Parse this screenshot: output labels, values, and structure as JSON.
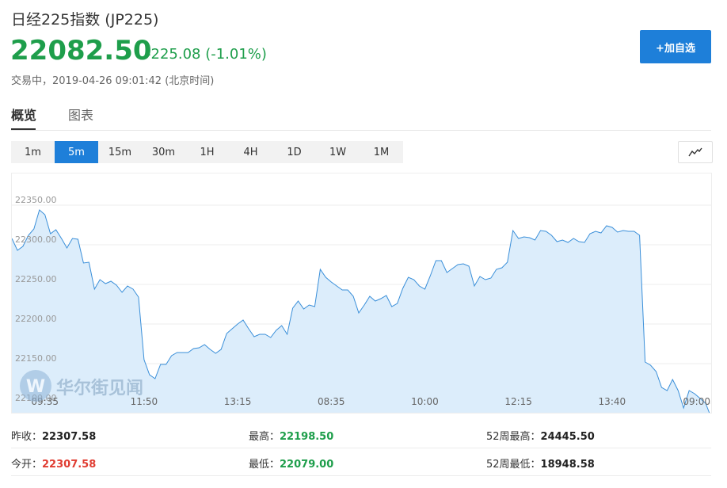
{
  "header": {
    "title": "日经225指数  (JP225)",
    "price": "22082.50",
    "change": "-225.08 (-1.01%)",
    "status": "交易中，2019-04-26 09:01:42 (北京时间)",
    "add_button": "+加自选"
  },
  "tabs": [
    "概览",
    "图表"
  ],
  "intervals": [
    "1m",
    "5m",
    "15m",
    "30m",
    "1H",
    "4H",
    "1D",
    "1W",
    "1M"
  ],
  "active_interval": "5m",
  "chart_icon": "line-chart-icon",
  "watermark": "华尔街见闻",
  "colors": {
    "accent": "#1e7fd9",
    "up": "#e03c31",
    "down": "#1e9e4b",
    "line": "#3a8fd9",
    "area": "#dcedfb"
  },
  "chart_data": {
    "type": "area",
    "ylim": [
      22075,
      22375
    ],
    "y_ticks": [
      22100,
      22150,
      22200,
      22250,
      22300,
      22350
    ],
    "y_tick_labels": [
      "22100.00",
      "22150.00",
      "22200.00",
      "22250.00",
      "22300.00",
      "22350.00"
    ],
    "x_tick_labels": [
      "09:35",
      "11:50",
      "13:15",
      "08:35",
      "10:00",
      "12:15",
      "13:40",
      "09:00"
    ],
    "x_tick_index": [
      6,
      24,
      41,
      58,
      75,
      92,
      109,
      126
    ],
    "values": [
      22308,
      22293,
      22298,
      22312,
      22320,
      22344,
      22338,
      22314,
      22319,
      22308,
      22296,
      22308,
      22307,
      22277,
      22278,
      22244,
      22256,
      22251,
      22254,
      22249,
      22240,
      22248,
      22244,
      22234,
      22155,
      22136,
      22131,
      22149,
      22149,
      22160,
      22164,
      22164,
      22164,
      22169,
      22170,
      22174,
      22168,
      22163,
      22168,
      22188,
      22194,
      22200,
      22205,
      22194,
      22184,
      22187,
      22187,
      22183,
      22192,
      22198,
      22187,
      22220,
      22229,
      22219,
      22224,
      22222,
      22269,
      22259,
      22253,
      22248,
      22243,
      22243,
      22235,
      22214,
      22224,
      22235,
      22229,
      22232,
      22236,
      22222,
      22226,
      22245,
      22259,
      22256,
      22248,
      22244,
      22261,
      22280,
      22280,
      22265,
      22270,
      22275,
      22276,
      22273,
      22248,
      22260,
      22256,
      22258,
      22269,
      22271,
      22278,
      22318,
      22308,
      22310,
      22309,
      22306,
      22318,
      22317,
      22312,
      22304,
      22306,
      22303,
      22308,
      22304,
      22303,
      22314,
      22317,
      22315,
      22324,
      22322,
      22316,
      22318,
      22317,
      22317,
      22312,
      22152,
      22148,
      22140,
      22120,
      22116,
      22130,
      22116,
      22094,
      22116,
      22112,
      22106,
      22100,
      22082
    ]
  },
  "stats": {
    "prev_close_label": "昨收：",
    "prev_close": "22307.58",
    "high_label": "最高：",
    "high": "22198.50",
    "week52_high_label": "52周最高：",
    "week52_high": "24445.50",
    "open_label": "今开：",
    "open": "22307.58",
    "low_label": "最低：",
    "low": "22079.00",
    "week52_low_label": "52周最低：",
    "week52_low": "18948.58"
  }
}
